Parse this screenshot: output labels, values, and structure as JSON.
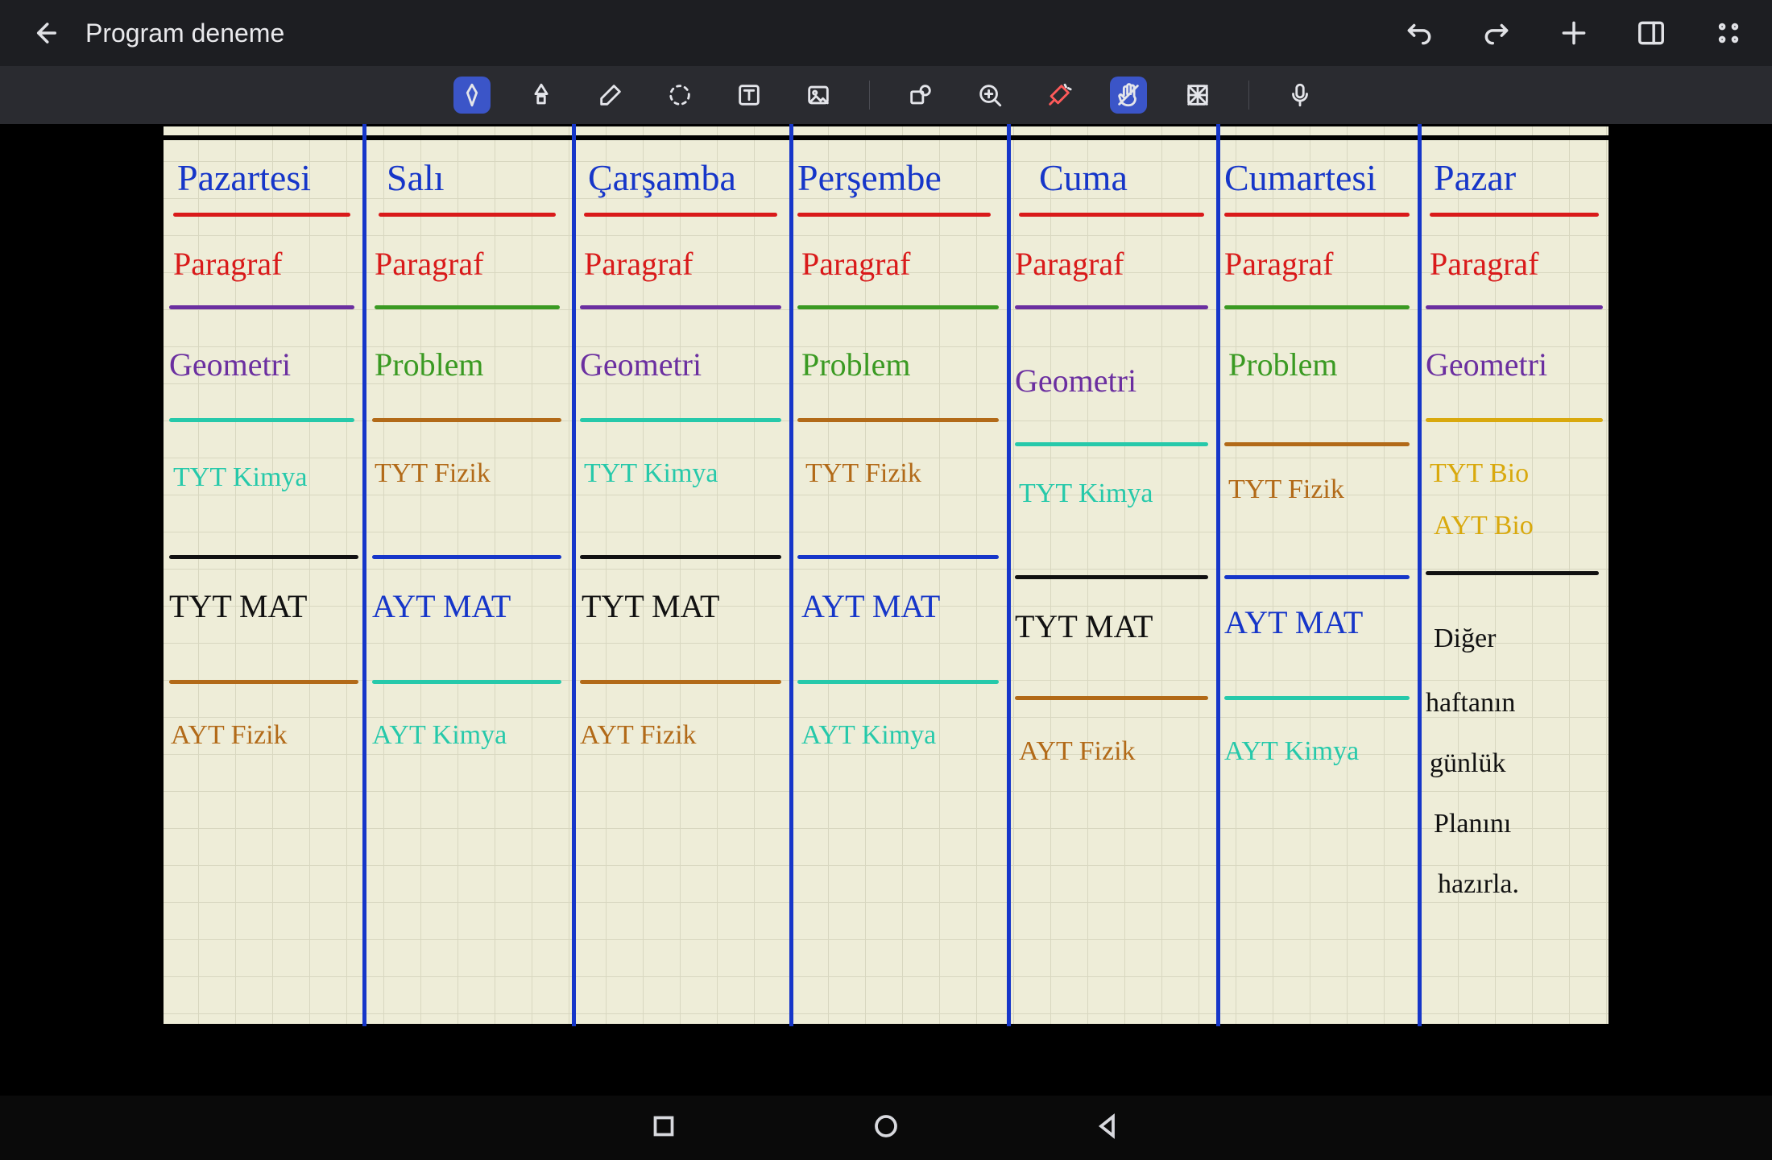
{
  "app": {
    "title": "Program deneme"
  },
  "toolbar": {
    "tools": [
      "pen",
      "highlighter",
      "eraser",
      "lasso",
      "text",
      "image",
      "sep",
      "shape",
      "zoom",
      "laser",
      "hand",
      "pattern",
      "sep",
      "mic"
    ],
    "active": "pen"
  },
  "colors": {
    "blue": "#1636c9",
    "red": "#d91a1a",
    "purple": "#6b2fa0",
    "green": "#3a9a22",
    "teal": "#26c9aa",
    "brown": "#b26a18",
    "black": "#111111",
    "yellow": "#d9a90d"
  },
  "schedule": {
    "days": [
      "Pazartesi",
      "Salı",
      "Çarşamba",
      "Perşembe",
      "Cuma",
      "Cumartesi",
      "Pazar"
    ],
    "rows": [
      {
        "id": "paragraf",
        "colorClass": "c-red",
        "ulClass": "b-purple",
        "cells": [
          "Paragraf",
          "Paragraf",
          "Paragraf",
          "Paragraf",
          "Paragraf",
          "Paragraf",
          "Paragraf"
        ]
      },
      {
        "id": "geo-problem",
        "colorClassPattern": [
          "c-purple",
          "c-green"
        ],
        "ulClassPattern": [
          "b-teal",
          "b-brown"
        ],
        "cells": [
          "Geometri",
          "Problem",
          "Geometri",
          "Problem",
          "Geometri",
          "Problem",
          "Geometri"
        ]
      },
      {
        "id": "tyt-sci",
        "colorClassPattern": [
          "c-teal",
          "c-brown"
        ],
        "ulClassPattern": [
          "b-black",
          "b-blue"
        ],
        "cells": [
          "TYT Kimya",
          "TYT Fizik",
          "TYT Kimya",
          "TYT Fizik",
          "TYT Kimya",
          "TYT Fizik",
          "TYT Bio"
        ]
      },
      {
        "id": "ayt-bio",
        "single": true,
        "cell": "AYT Bio",
        "colorClass": "c-yellow"
      },
      {
        "id": "mat",
        "colorClassPattern": [
          "c-black",
          "c-blue"
        ],
        "ulClassPattern": [
          "b-brown",
          "b-teal"
        ],
        "cells": [
          "TYT MAT",
          "AYT MAT",
          "TYT MAT",
          "AYT MAT",
          "TYT MAT",
          "AYT MAT",
          ""
        ]
      },
      {
        "id": "ayt-sci",
        "colorClassPattern": [
          "c-brown",
          "c-teal"
        ],
        "ulClass": "",
        "cells": [
          "AYT Fizik",
          "AYT Kimya",
          "AYT Fizik",
          "AYT Kimya",
          "AYT Fizik",
          "AYT Kimya",
          ""
        ]
      }
    ],
    "note": {
      "lines": [
        "Diğer",
        "haftanın",
        "günlük",
        "Planını",
        "hazırla."
      ]
    }
  },
  "chart_data": {
    "type": "table",
    "title": "Weekly study schedule",
    "columns": [
      "Pazartesi",
      "Salı",
      "Çarşamba",
      "Perşembe",
      "Cuma",
      "Cumartesi",
      "Pazar"
    ],
    "rows": [
      [
        "Paragraf",
        "Paragraf",
        "Paragraf",
        "Paragraf",
        "Paragraf",
        "Paragraf",
        "Paragraf"
      ],
      [
        "Geometri",
        "Problem",
        "Geometri",
        "Problem",
        "Geometri",
        "Problem",
        "Geometri"
      ],
      [
        "TYT Kimya",
        "TYT Fizik",
        "TYT Kimya",
        "TYT Fizik",
        "TYT Kimya",
        "TYT Fizik",
        "TYT Bio / AYT Bio"
      ],
      [
        "TYT MAT",
        "AYT MAT",
        "TYT MAT",
        "AYT MAT",
        "TYT MAT",
        "AYT MAT",
        "Diğer haftanın günlük Planını hazırla."
      ],
      [
        "AYT Fizik",
        "AYT Kimya",
        "AYT Fizik",
        "AYT Kimya",
        "AYT Fizik",
        "AYT Kimya",
        ""
      ]
    ]
  }
}
